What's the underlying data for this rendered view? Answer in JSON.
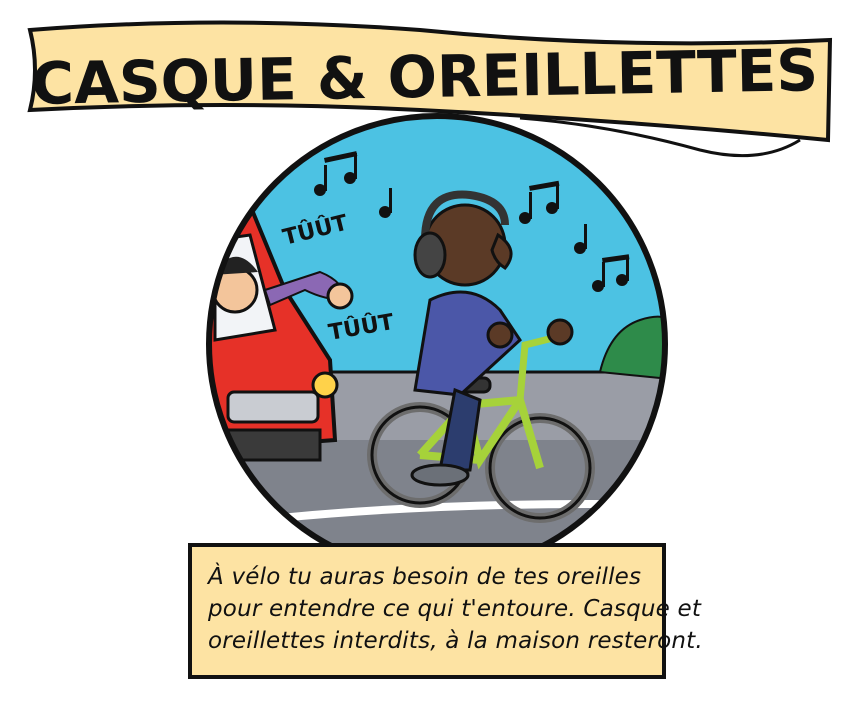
{
  "banner": {
    "title": "CASQUE & OREILLETTES"
  },
  "sounds": {
    "honk1": "TÛÛT",
    "honk2": "TÛÛT"
  },
  "caption": {
    "line1": "À vélo tu auras besoin de tes oreilles",
    "line2": "pour entendre ce qui t'entoure. Casque et",
    "line3": "oreillettes interdits, à la maison resteront."
  },
  "colors": {
    "banner": "#fde3a3",
    "sky": "#4cc2e3",
    "road": "#8c8f99",
    "car": "#e63128",
    "bike": "#a6d23a",
    "sweater": "#4b57a8"
  }
}
